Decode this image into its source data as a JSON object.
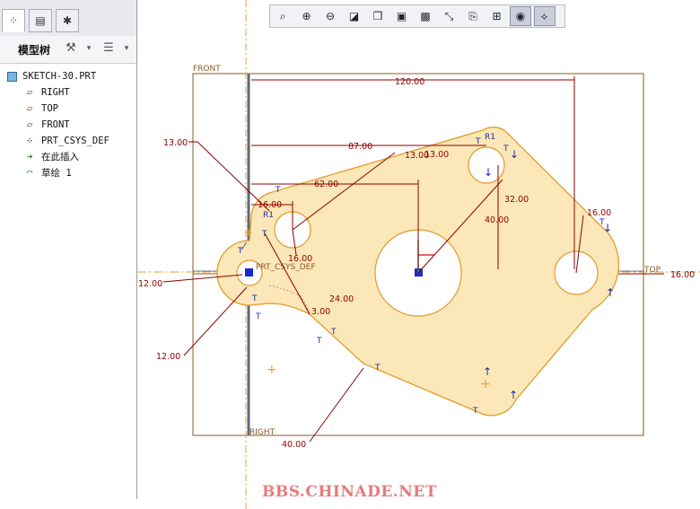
{
  "model_tree": {
    "title": "模型树",
    "items": [
      {
        "label": "SKETCH-30.PRT",
        "icon": "part-icon"
      },
      {
        "label": "RIGHT",
        "icon": "datum-plane-icon"
      },
      {
        "label": "TOP",
        "icon": "datum-plane-icon"
      },
      {
        "label": "FRONT",
        "icon": "datum-plane-icon"
      },
      {
        "label": "PRT_CSYS_DEF",
        "icon": "csys-icon"
      },
      {
        "label": "在此插入",
        "icon": "insert-arrow-icon"
      },
      {
        "label": "草绘 1",
        "icon": "sketch-icon"
      }
    ]
  },
  "toolbar": {
    "buttons": [
      "zoom-to-fit",
      "zoom-in",
      "zoom-out",
      "repaint",
      "orient",
      "saved-views",
      "layers",
      "dimensions",
      "constraints",
      "grid",
      "sketch-display",
      "vertex-display"
    ]
  },
  "sketch": {
    "planes": {
      "front": "FRONT",
      "right": "RIGHT",
      "top": "TOP",
      "csys": "PRT_CSYS_DEF"
    },
    "dimensions": [
      "120.00",
      "87.00",
      "62.00",
      "16.00",
      "16.00",
      "13.00",
      "13.00",
      "13.00",
      "32.00",
      "40.00",
      "16.00",
      "16.00",
      "12.00",
      "12.00",
      "24.00",
      "3.00",
      "40.00"
    ],
    "radius_labels": [
      "R1",
      "R1"
    ]
  },
  "watermark": "BBS.CHINADE.NET",
  "colors": {
    "sketch_fill": "#fce7b8",
    "sketch_edge": "#e39a2a",
    "dimension": "#8b0000",
    "datum": "#8a5a2a"
  }
}
